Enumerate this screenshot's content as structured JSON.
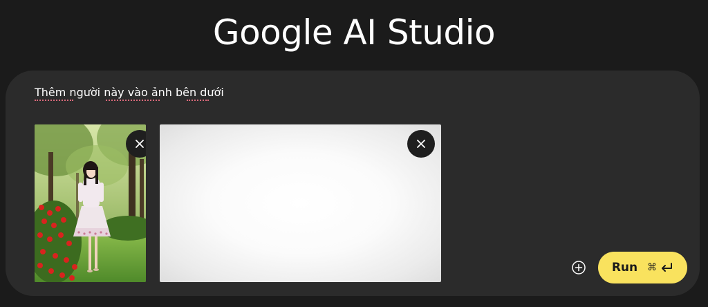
{
  "app": {
    "title": "Google AI Studio"
  },
  "composer": {
    "prompt_text": "Thêm người này vào ảnh bên dưới",
    "attachments": [
      {
        "kind": "image",
        "description_icon": "photo-woman-garden",
        "remove_icon": "close-icon"
      },
      {
        "kind": "image",
        "description_icon": "blank-white-image",
        "remove_icon": "close-icon"
      }
    ],
    "add_icon": "plus-circle-icon",
    "run_button": {
      "label": "Run",
      "shortcut_symbol": "⌘",
      "shortcut_icon": "enter-key-icon"
    }
  },
  "colors": {
    "page_background": "#1b1b1b",
    "composer_background": "#2b2b2b",
    "run_button_background": "#f9e25e",
    "spellcheck_underline": "#d9697a"
  }
}
